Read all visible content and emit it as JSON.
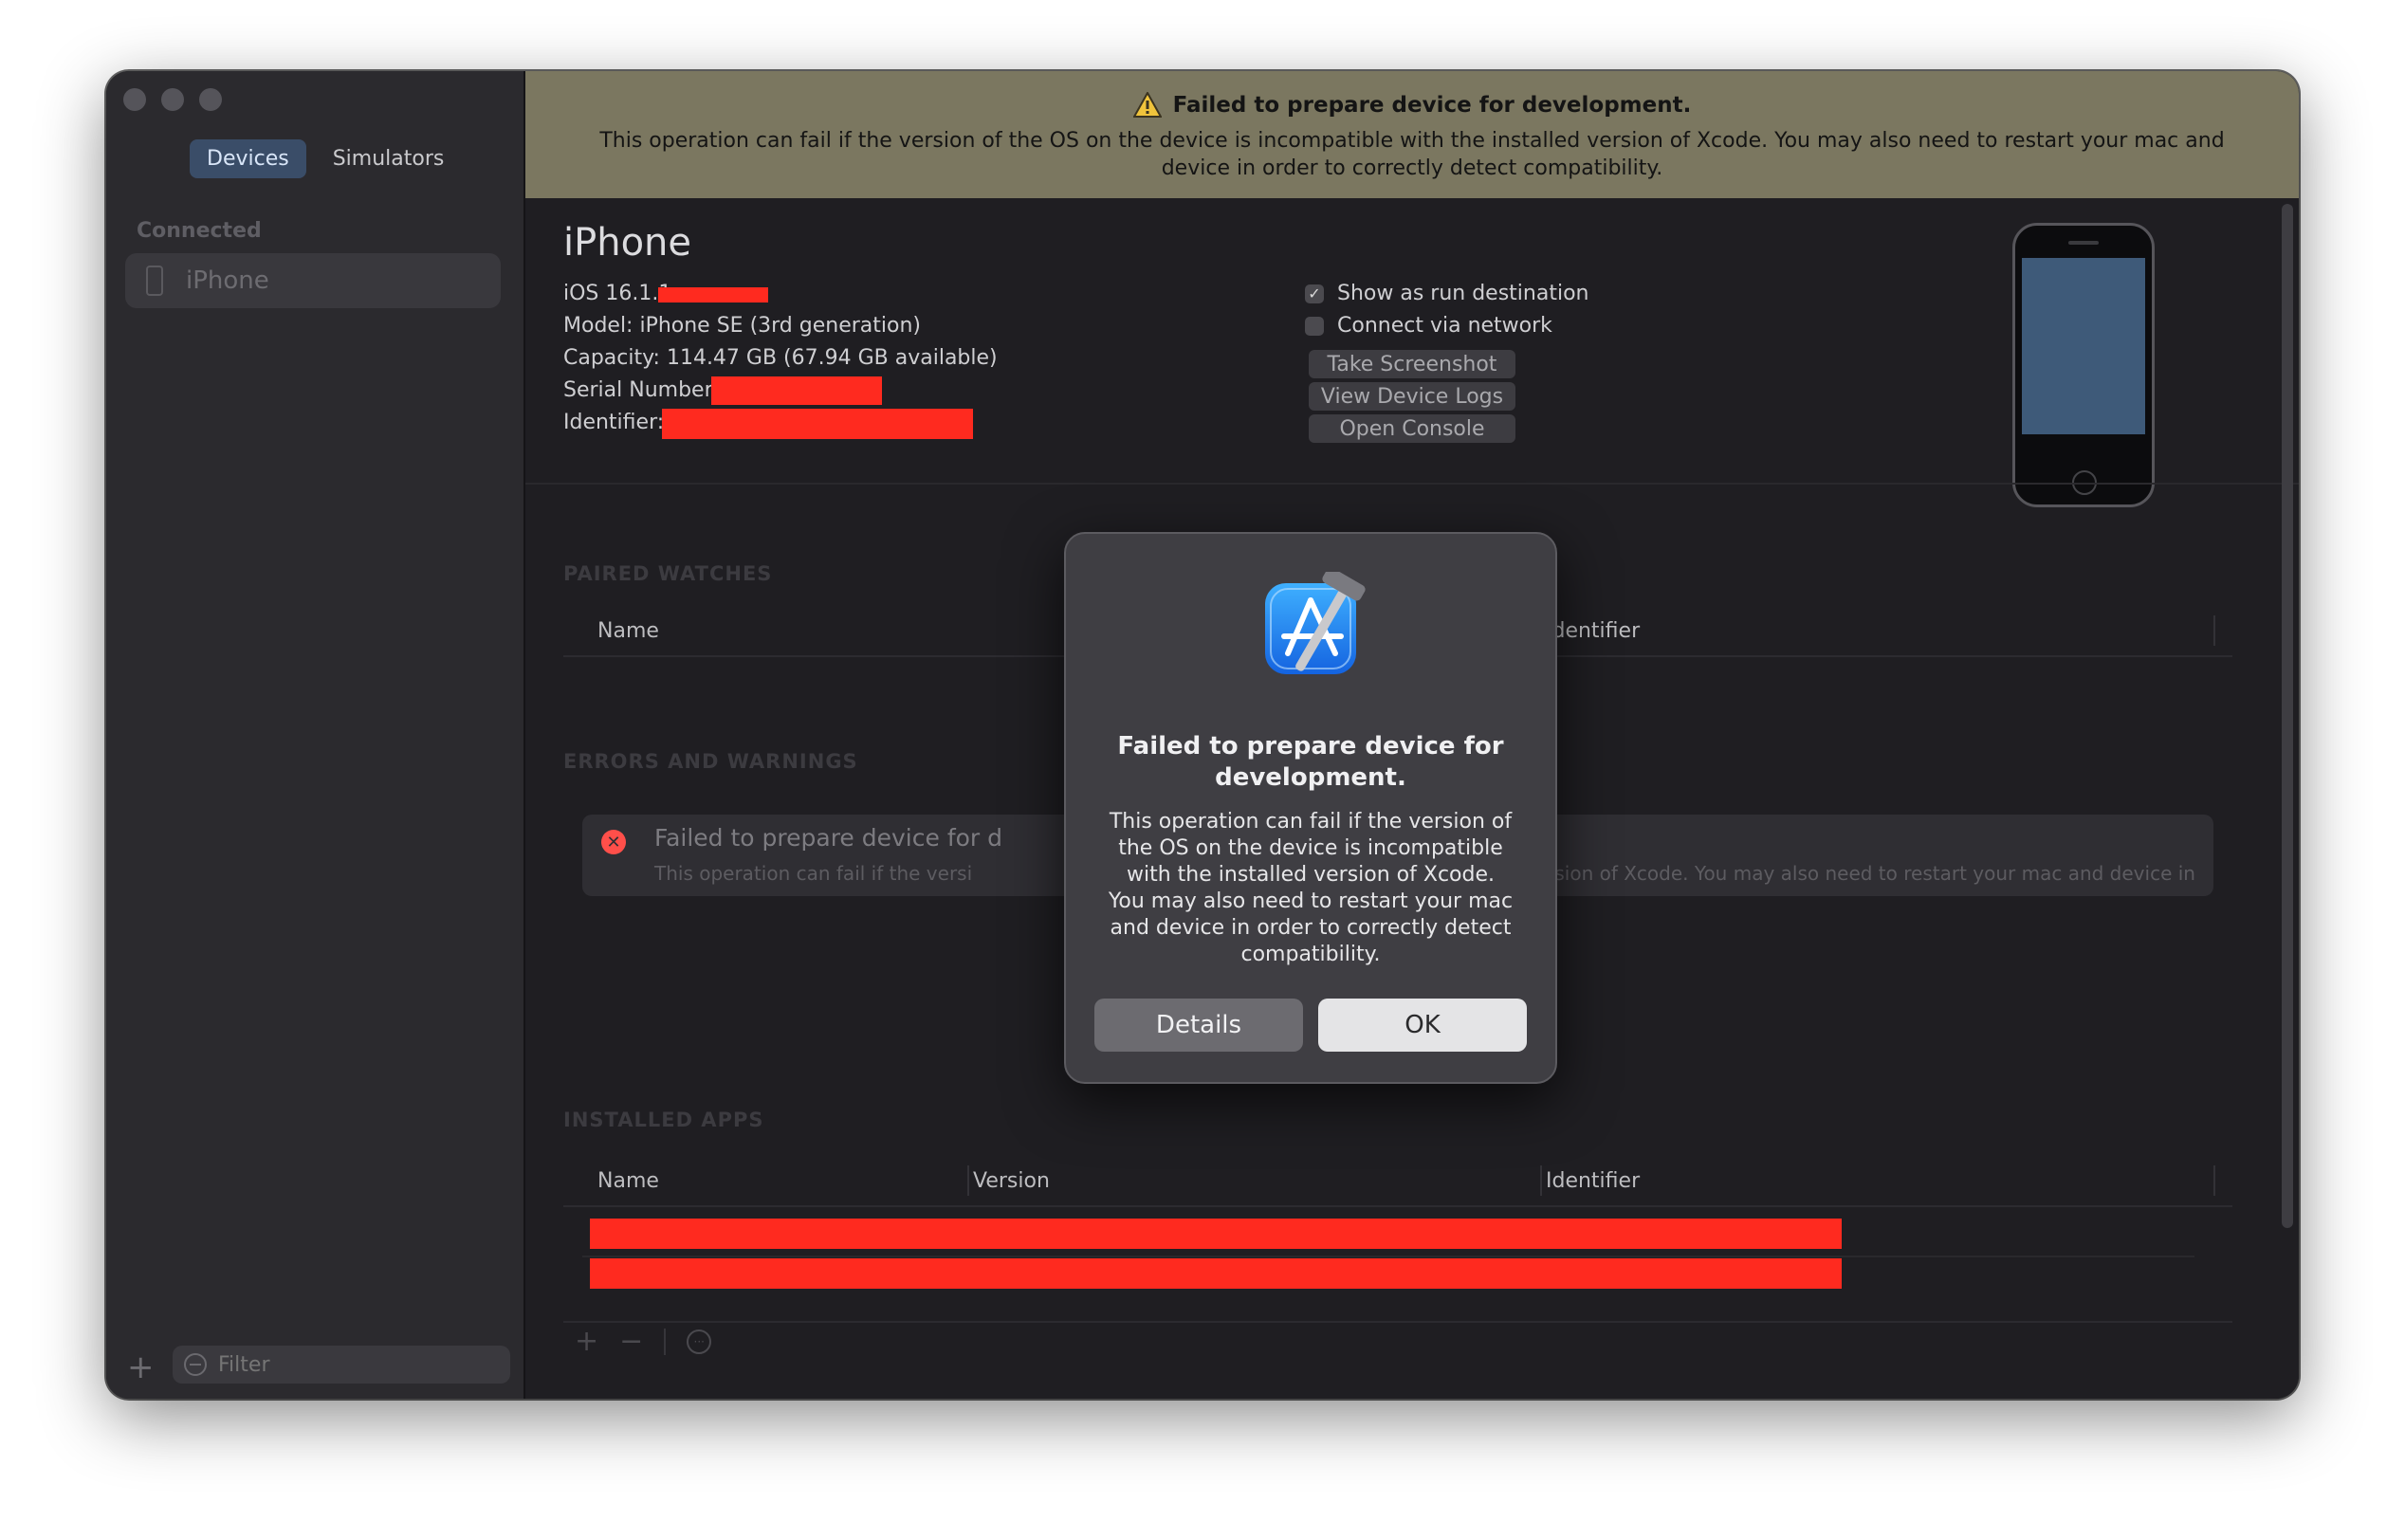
{
  "sidebar": {
    "tabs": [
      {
        "label": "Devices",
        "active": true
      },
      {
        "label": "Simulators",
        "active": false
      }
    ],
    "section_label": "Connected",
    "devices": [
      {
        "label": "iPhone",
        "icon": "iphone-icon"
      }
    ],
    "filter_placeholder": "Filter"
  },
  "banner": {
    "icon": "warning-triangle-icon",
    "title": "Failed to prepare device for development.",
    "message": "This operation can fail if the version of the OS on the device is incompatible with the installed version of Xcode. You may also need to restart your mac and device in order to correctly detect compatibility."
  },
  "device": {
    "name": "iPhone",
    "ios_version": "iOS 16.1.1",
    "model": "Model: iPhone SE (3rd generation)",
    "capacity": "Capacity: 114.47 GB (67.94 GB available)",
    "serial_label": "Serial Number:",
    "identifier_label": "Identifier:"
  },
  "options": {
    "show_as_run_destination": {
      "label": "Show as run destination",
      "checked": true
    },
    "connect_via_network": {
      "label": "Connect via network",
      "checked": false
    },
    "buttons": [
      "Take Screenshot",
      "View Device Logs",
      "Open Console"
    ]
  },
  "paired_watches": {
    "section_label": "PAIRED WATCHES",
    "columns": [
      "Name",
      "Identifier"
    ]
  },
  "errors": {
    "section_label": "ERRORS AND WARNINGS",
    "item": {
      "title": "Failed to prepare device for d",
      "message_left": "This operation can fail if the versi",
      "message_right": "stalled version of Xcode. You may also need to restart your mac and device in or..."
    }
  },
  "installed_apps": {
    "section_label": "INSTALLED APPS",
    "columns": [
      "Name",
      "Version",
      "Identifier"
    ]
  },
  "modal": {
    "icon": "xcode-app-icon",
    "title": "Failed to prepare device for development.",
    "message": "This operation can fail if the version of the OS on the device is incompatible with the installed version of Xcode. You may also need to restart your mac and device in order to correctly detect compatibility.",
    "details_label": "Details",
    "ok_label": "OK"
  },
  "colors": {
    "banner": "#7b7760",
    "redaction": "#ff2a1f",
    "accent": "#3a4d68"
  }
}
